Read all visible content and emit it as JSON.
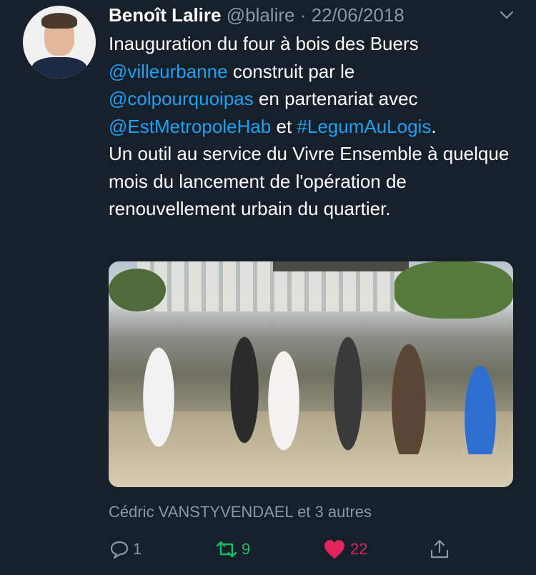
{
  "tweet": {
    "author": {
      "name": "Benoît Lalire",
      "handle": "@blalire"
    },
    "separator": "·",
    "date": "22/06/2018",
    "text_parts": {
      "p1": "Inauguration du four à bois des Buers",
      "m1": "@villeurbanne",
      "p2": " construit par le",
      "m2": "@colpourquoipas",
      "p3": " en partenariat avec",
      "m3": "@EstMetropoleHab",
      "p4": " et ",
      "h1": "#LegumAuLogis",
      "p5": ".",
      "p6": "Un outil au service du Vivre Ensemble à quelque mois du lancement de l'opération de renouvellement urbain du quartier."
    },
    "social_context": "Cédric VANSTYVENDAEL et 3 autres",
    "actions": {
      "reply_count": "1",
      "retweet_count": "9",
      "like_count": "22"
    }
  },
  "colors": {
    "background": "#15202b",
    "link": "#1da1f2",
    "muted": "#8899a6",
    "retweet": "#17bf63",
    "like": "#e0245e"
  },
  "icons": [
    "chevron-down-icon",
    "reply-icon",
    "retweet-icon",
    "heart-icon",
    "share-icon"
  ]
}
